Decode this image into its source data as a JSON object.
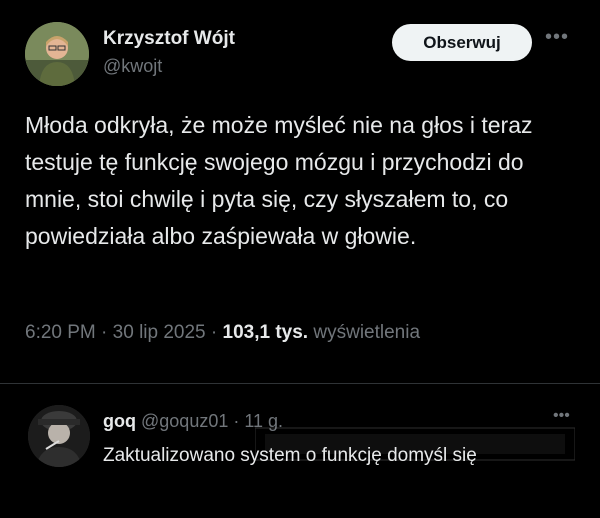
{
  "tweet": {
    "author": {
      "name": "Krzysztof Wójt",
      "handle": "@kwojt"
    },
    "follow_label": "Obserwuj",
    "more_icon": "ellipsis-icon",
    "text": "Młoda odkryła, że może myśleć nie na głos i teraz testuje tę funkcję swojego mózgu i przychodzi do mnie, stoi chwilę i pyta się, czy słyszałem to, co powiedziała albo zaśpiewała w głowie.",
    "meta": {
      "time": "6:20 PM",
      "sep1": " · ",
      "date": "30 lip 2025",
      "sep2": " · ",
      "views": "103,1 tys.",
      "views_label": " wyświetlenia"
    }
  },
  "reply": {
    "name": "goq",
    "handle": "@goquz01",
    "sep": " · ",
    "age": "11 g.",
    "text": "Zaktualizowano system o funkcję domyśl się",
    "more_icon": "ellipsis-icon"
  },
  "colors": {
    "background": "#000000",
    "text": "#e7e9ea",
    "secondary": "#71767b",
    "button": "#eff3f4",
    "divider": "#2f3336"
  }
}
